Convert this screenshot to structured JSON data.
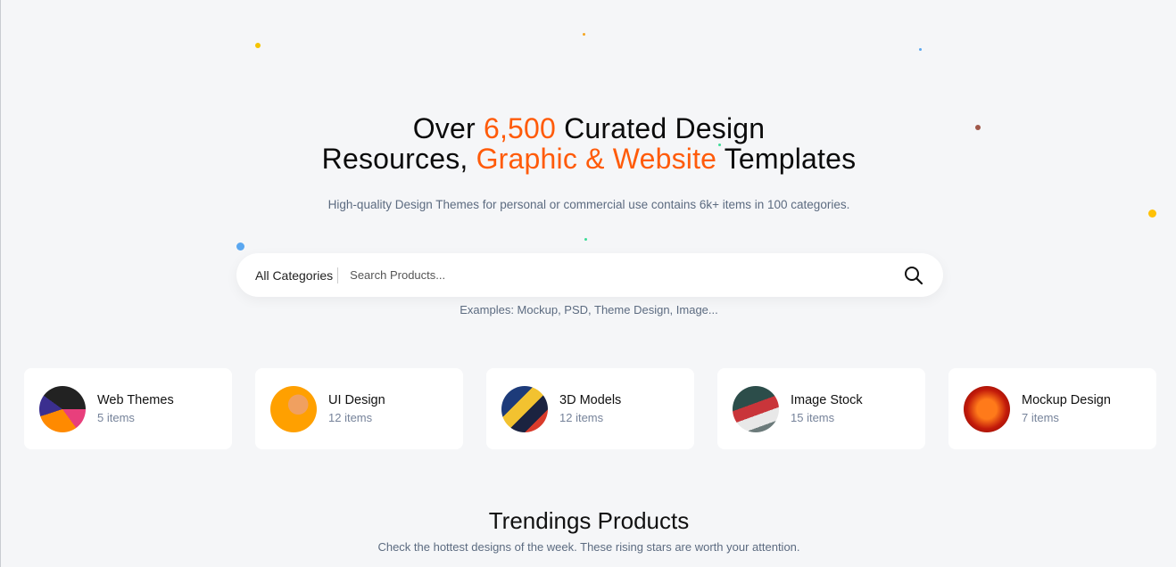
{
  "hero": {
    "line1_a": "Over ",
    "line1_highlight": "6,500",
    "line1_b": " Curated Design",
    "line2_a": "Resources, ",
    "line2_highlight": "Graphic & Website",
    "line2_b": " Templates",
    "subtitle": "High-quality Design Themes for personal or commercial use contains 6k+ items in 100 categories."
  },
  "search": {
    "category": "All Categories",
    "placeholder": "Search Products...",
    "value": "",
    "icon": "search-icon",
    "examples": "Examples: Mockup, PSD, Theme Design, Image..."
  },
  "categories": [
    {
      "title": "Web Themes",
      "count": "5 items"
    },
    {
      "title": "UI Design",
      "count": "12 items"
    },
    {
      "title": "3D Models",
      "count": "12 items"
    },
    {
      "title": "Image Stock",
      "count": "15 items"
    },
    {
      "title": "Mockup Design",
      "count": "7 items"
    }
  ],
  "trending": {
    "title": "Trendings Products",
    "subtitle": "Check the hottest designs of the week. These rising stars are worth your attention."
  },
  "colors": {
    "accent": "#ff5b0a",
    "background": "#f5f6f8"
  }
}
